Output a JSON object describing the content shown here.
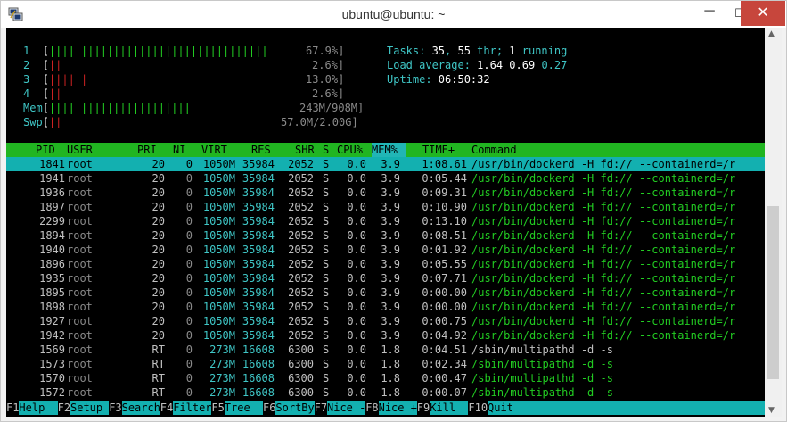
{
  "window": {
    "title": "ubuntu@ubuntu: ~",
    "min": "─",
    "max": "☐",
    "close": "✕"
  },
  "meters": {
    "cpus": [
      {
        "id": "1",
        "bars": "||||||||||||||||||||||||||||||||||",
        "percent": "67.9%]"
      },
      {
        "id": "2",
        "bars": "||",
        "percent": "2.6%]"
      },
      {
        "id": "3",
        "bars": "||||||",
        "percent": "13.0%]"
      },
      {
        "id": "4",
        "bars": "||",
        "percent": "2.6%]"
      }
    ],
    "mem": {
      "label": "Mem",
      "bars": "||||||||||||||||||||||",
      "value": "243M/908M]"
    },
    "swp": {
      "label": "Swp",
      "bars": "||",
      "value": "57.0M/2.00G]"
    }
  },
  "stats": {
    "tasks_label": "Tasks: ",
    "tasks": "35",
    "thr_sep": ", ",
    "thr": "55",
    "thr_label": " thr; ",
    "running": "1",
    "running_label": " running",
    "load_label": "Load average: ",
    "load1": "1.64",
    "load5": "0.69",
    "load15": "0.27",
    "uptime_label": "Uptime: ",
    "uptime": "06:50:32"
  },
  "table": {
    "headers": {
      "pid": "PID",
      "user": "USER",
      "pri": "PRI",
      "ni": "NI",
      "virt": "VIRT",
      "res": "RES",
      "shr": "SHR",
      "s": "S",
      "cpu": "CPU%",
      "mem": "MEM%",
      "time": "TIME+",
      "command": "Command"
    },
    "rows": [
      {
        "pid": "1841",
        "user": "root",
        "pri": "20",
        "ni": "0",
        "virt": "1050M",
        "res": "35984",
        "shr": "2052",
        "s": "S",
        "cpu": "0.0",
        "mem": "3.9",
        "time": "1:08.61",
        "command": "/usr/bin/dockerd -H fd:// --containerd=/r"
      },
      {
        "pid": "1941",
        "user": "root",
        "pri": "20",
        "ni": "0",
        "virt": "1050M",
        "res": "35984",
        "shr": "2052",
        "s": "S",
        "cpu": "0.0",
        "mem": "3.9",
        "time": "0:05.44",
        "command": "/usr/bin/dockerd -H fd:// --containerd=/r"
      },
      {
        "pid": "1936",
        "user": "root",
        "pri": "20",
        "ni": "0",
        "virt": "1050M",
        "res": "35984",
        "shr": "2052",
        "s": "S",
        "cpu": "0.0",
        "mem": "3.9",
        "time": "0:09.31",
        "command": "/usr/bin/dockerd -H fd:// --containerd=/r"
      },
      {
        "pid": "1897",
        "user": "root",
        "pri": "20",
        "ni": "0",
        "virt": "1050M",
        "res": "35984",
        "shr": "2052",
        "s": "S",
        "cpu": "0.0",
        "mem": "3.9",
        "time": "0:10.90",
        "command": "/usr/bin/dockerd -H fd:// --containerd=/r"
      },
      {
        "pid": "2299",
        "user": "root",
        "pri": "20",
        "ni": "0",
        "virt": "1050M",
        "res": "35984",
        "shr": "2052",
        "s": "S",
        "cpu": "0.0",
        "mem": "3.9",
        "time": "0:13.10",
        "command": "/usr/bin/dockerd -H fd:// --containerd=/r"
      },
      {
        "pid": "1894",
        "user": "root",
        "pri": "20",
        "ni": "0",
        "virt": "1050M",
        "res": "35984",
        "shr": "2052",
        "s": "S",
        "cpu": "0.0",
        "mem": "3.9",
        "time": "0:08.51",
        "command": "/usr/bin/dockerd -H fd:// --containerd=/r"
      },
      {
        "pid": "1940",
        "user": "root",
        "pri": "20",
        "ni": "0",
        "virt": "1050M",
        "res": "35984",
        "shr": "2052",
        "s": "S",
        "cpu": "0.0",
        "mem": "3.9",
        "time": "0:01.92",
        "command": "/usr/bin/dockerd -H fd:// --containerd=/r"
      },
      {
        "pid": "1896",
        "user": "root",
        "pri": "20",
        "ni": "0",
        "virt": "1050M",
        "res": "35984",
        "shr": "2052",
        "s": "S",
        "cpu": "0.0",
        "mem": "3.9",
        "time": "0:05.55",
        "command": "/usr/bin/dockerd -H fd:// --containerd=/r"
      },
      {
        "pid": "1935",
        "user": "root",
        "pri": "20",
        "ni": "0",
        "virt": "1050M",
        "res": "35984",
        "shr": "2052",
        "s": "S",
        "cpu": "0.0",
        "mem": "3.9",
        "time": "0:07.71",
        "command": "/usr/bin/dockerd -H fd:// --containerd=/r"
      },
      {
        "pid": "1895",
        "user": "root",
        "pri": "20",
        "ni": "0",
        "virt": "1050M",
        "res": "35984",
        "shr": "2052",
        "s": "S",
        "cpu": "0.0",
        "mem": "3.9",
        "time": "0:00.00",
        "command": "/usr/bin/dockerd -H fd:// --containerd=/r"
      },
      {
        "pid": "1898",
        "user": "root",
        "pri": "20",
        "ni": "0",
        "virt": "1050M",
        "res": "35984",
        "shr": "2052",
        "s": "S",
        "cpu": "0.0",
        "mem": "3.9",
        "time": "0:00.00",
        "command": "/usr/bin/dockerd -H fd:// --containerd=/r"
      },
      {
        "pid": "1927",
        "user": "root",
        "pri": "20",
        "ni": "0",
        "virt": "1050M",
        "res": "35984",
        "shr": "2052",
        "s": "S",
        "cpu": "0.0",
        "mem": "3.9",
        "time": "0:00.75",
        "command": "/usr/bin/dockerd -H fd:// --containerd=/r"
      },
      {
        "pid": "1942",
        "user": "root",
        "pri": "20",
        "ni": "0",
        "virt": "1050M",
        "res": "35984",
        "shr": "2052",
        "s": "S",
        "cpu": "0.0",
        "mem": "3.9",
        "time": "0:04.92",
        "command": "/usr/bin/dockerd -H fd:// --containerd=/r"
      },
      {
        "pid": "1569",
        "user": "root",
        "pri": "RT",
        "ni": "0",
        "virt": "273M",
        "res": "16608",
        "shr": "6300",
        "s": "S",
        "cpu": "0.0",
        "mem": "1.8",
        "time": "0:04.51",
        "command": "/sbin/multipathd -d -s"
      },
      {
        "pid": "1573",
        "user": "root",
        "pri": "RT",
        "ni": "0",
        "virt": "273M",
        "res": "16608",
        "shr": "6300",
        "s": "S",
        "cpu": "0.0",
        "mem": "1.8",
        "time": "0:02.34",
        "command": "/sbin/multipathd -d -s"
      },
      {
        "pid": "1570",
        "user": "root",
        "pri": "RT",
        "ni": "0",
        "virt": "273M",
        "res": "16608",
        "shr": "6300",
        "s": "S",
        "cpu": "0.0",
        "mem": "1.8",
        "time": "0:00.47",
        "command": "/sbin/multipathd -d -s"
      },
      {
        "pid": "1572",
        "user": "root",
        "pri": "RT",
        "ni": "0",
        "virt": "273M",
        "res": "16608",
        "shr": "6300",
        "s": "S",
        "cpu": "0.0",
        "mem": "1.8",
        "time": "0:00.07",
        "command": "/sbin/multipathd -d -s"
      }
    ]
  },
  "fkeys": [
    {
      "key": "F1",
      "label": "Help  "
    },
    {
      "key": "F2",
      "label": "Setup "
    },
    {
      "key": "F3",
      "label": "Search"
    },
    {
      "key": "F4",
      "label": "Filter"
    },
    {
      "key": "F5",
      "label": "Tree  "
    },
    {
      "key": "F6",
      "label": "SortBy"
    },
    {
      "key": "F7",
      "label": "Nice -"
    },
    {
      "key": "F8",
      "label": "Nice +"
    },
    {
      "key": "F9",
      "label": "Kill  "
    },
    {
      "key": "F10",
      "label": "Quit"
    }
  ],
  "colors": {
    "header_bg": "#21b521",
    "selection_bg": "#13b0b0",
    "cyan_text": "#3fc6c6",
    "close_btn": "#c7463c"
  }
}
